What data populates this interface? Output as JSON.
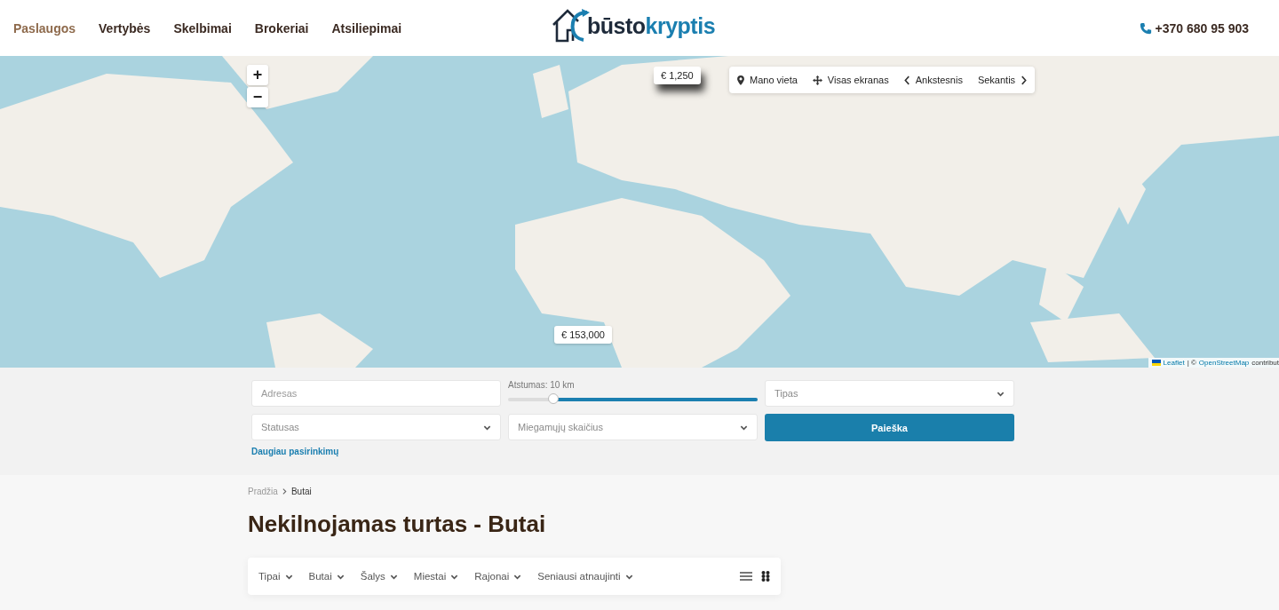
{
  "header": {
    "nav": [
      {
        "label": "Paslaugos",
        "selected": true
      },
      {
        "label": "Vertybės",
        "selected": false
      },
      {
        "label": "Skelbimai",
        "selected": false
      },
      {
        "label": "Brokeriai",
        "selected": false
      },
      {
        "label": "Atsiliepimai",
        "selected": false
      }
    ],
    "logo": {
      "part_1": "būsto",
      "part_2": "kryptis"
    },
    "phone": "+370 680 95 903"
  },
  "map": {
    "kind": "picture",
    "zoom_buttons": [
      "+",
      "−"
    ],
    "toolbar": [
      "Mano vieta",
      "Visas ekranas",
      "Ankstesnis",
      "Sekantis"
    ],
    "markers": [
      "€ 1,250",
      "€ 153,000"
    ],
    "attribution": {
      "leaflet": "Leaflet",
      "separator": "| ©",
      "osm": "OpenStreetMap",
      "rest": "contribut"
    }
  },
  "search": {
    "address": {
      "placeholder": "Adresas"
    },
    "distance": {
      "label": "Atstumas: 10 km",
      "level": 0.18
    },
    "type": {
      "placeholder": "Tipas"
    },
    "status": {
      "placeholder": "Statusas"
    },
    "bedrooms": {
      "placeholder": "Miegamųjų skaičius"
    },
    "button": "Paieška",
    "more_options": "Daugiau pasirinkimų"
  },
  "breadcrumb": [
    "Pradžia",
    "Butai"
  ],
  "heading": "Nekilnojamas turtas - Butai",
  "filters": [
    "Tipai",
    "Butai",
    "Šalys",
    "Miestai",
    "Rajonai",
    "Seniausi atnaujinti"
  ],
  "views": [
    {
      "kind": "list",
      "selected": false
    },
    {
      "kind": "grid",
      "selected": true
    }
  ]
}
